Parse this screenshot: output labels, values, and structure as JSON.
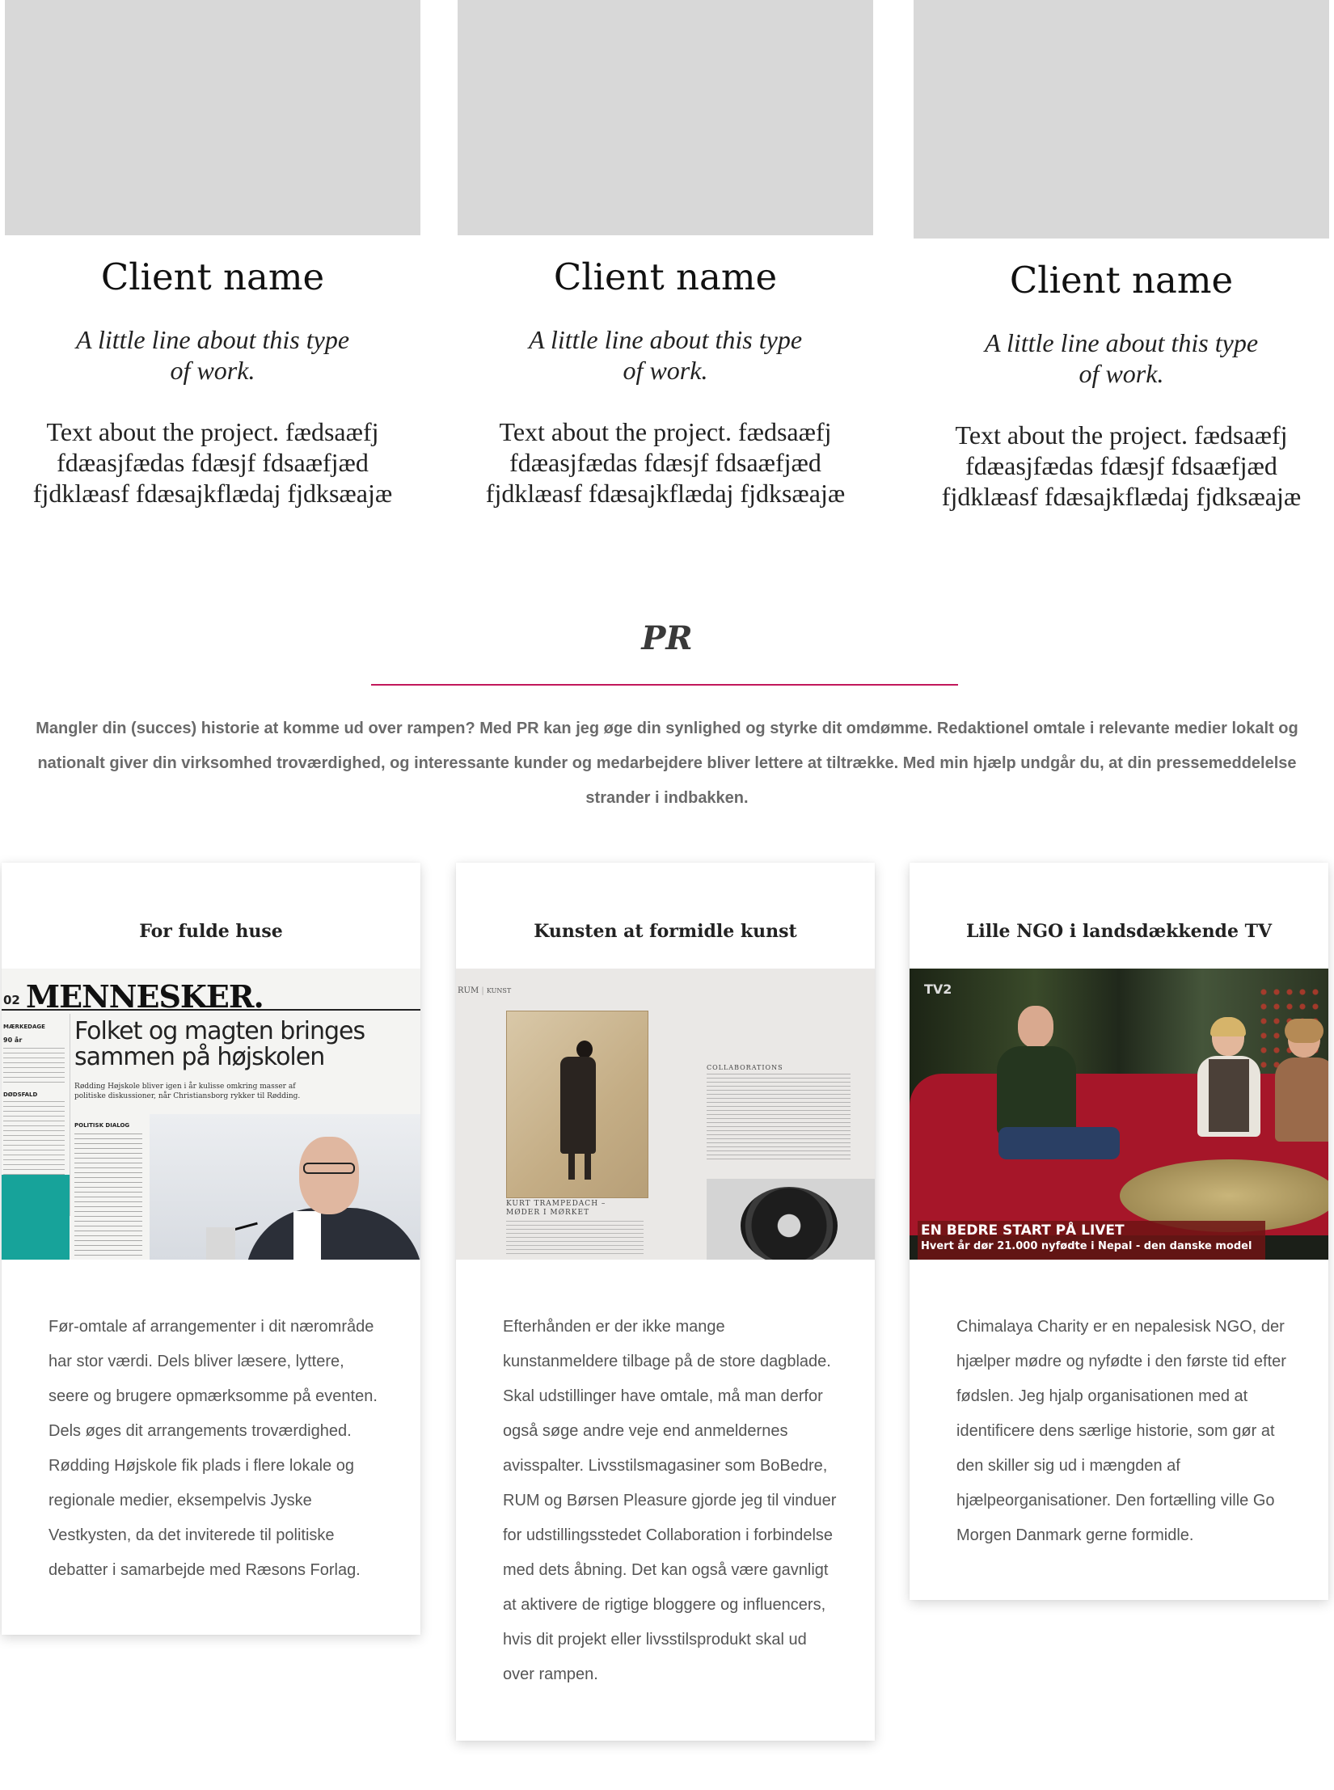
{
  "top_cards": [
    {
      "client_name": "Client name",
      "tagline": "A little line about this type of work.",
      "text": "Text about the project. fædsaæfj fdæasjfædas fdæsjf fdsaæfjæd fjdklæasf fdæsajkflædaj fjdksæajæ"
    },
    {
      "client_name": "Client name",
      "tagline": "A little line about this type of work.",
      "text": "Text about the project. fædsaæfj fdæasjfædas fdæsjf fdsaæfjæd fjdklæasf fdæsajkflædaj fjdksæajæ"
    },
    {
      "client_name": "Client name",
      "tagline": "A little line about this type of work.",
      "text": "Text about the project. fædsaæfj fdæasjfædas fdæsjf fdsaæfjæd fjdklæasf fdæsajkflædaj fjdksæajæ"
    }
  ],
  "pr": {
    "title": "PR",
    "intro": "Mangler din (succes) historie at komme ud over rampen? Med PR kan jeg øge din synlighed og styrke dit omdømme. Redaktionel omtale i relevante medier lokalt og nationalt giver din virksomhed troværdighed, og interessante kunder og medarbejdere bliver lettere at tiltrække. Med min hjælp undgår du, at din pressemeddelelse strander i indbakken.",
    "accent_color": "#c2185b"
  },
  "cases": [
    {
      "title": "For fulde huse",
      "body": "Før-omtale af arrangementer i dit nærområde har stor værdi. Dels bliver læsere, lyttere, seere og brugere opmærksomme på eventen. Dels øges dit arrangements troværdighed. Rødding Højskole fik plads i flere lokale og regionale medier, eksempelvis Jyske Vestkysten, da det inviterede til politiske debatter i samarbejde med Ræsons Forlag.",
      "image": {
        "masthead": "MENNESKER.",
        "page_no": "02",
        "headline": "Folket og magten bringes sammen på højskolen",
        "kicker": "Rødding Højskole bliver igen i år kulisse omkring masser af politiske diskussioner, når Christiansborg rykker til Rødding.",
        "section": "POLITISK DIALOG",
        "left_a": "MÆRKEDAGE",
        "left_b": "90 år",
        "left_c": "DØDSFALD"
      }
    },
    {
      "title": "Kunsten at formidle kunst",
      "body": "Efterhånden er der ikke mange kunstanmeldere tilbage på de store dagblade. Skal udstillinger have omtale, må man derfor også søge andre veje end anmeldernes avisspalter. Livsstilsmagasiner som BoBedre, RUM og Børsen Pleasure gjorde jeg til vinduer for udstillingsstedet Collaboration i forbindelse med dets åbning. Det kan også være gavnligt at aktivere de rigtige bloggere og influencers, hvis dit projekt eller livsstilsprodukt skal ud over rampen.",
      "image": {
        "header_left": "RUM",
        "header_right": "KUNST",
        "section": "COLLABORATIONS",
        "caption": "KURT TRAMPEDACH – MØDER I MØRKET"
      }
    },
    {
      "title": "Lille NGO i landsdækkende TV",
      "body": "Chimalaya Charity er en nepalesisk NGO, der hjælper mødre og nyfødte i den første tid efter fødslen. Jeg hjalp organisationen med at identificere dens særlige historie, som gør at den skiller sig ud i mængden af hjælpeorganisationer. Den fortælling ville Go Morgen Danmark gerne formidle.",
      "image": {
        "lower_third_title": "EN BEDRE START PÅ LIVET",
        "lower_third_sub": "Hvert år dør 21.000 nyfødte i Nepal - den danske model",
        "channel": "TV2"
      }
    }
  ]
}
